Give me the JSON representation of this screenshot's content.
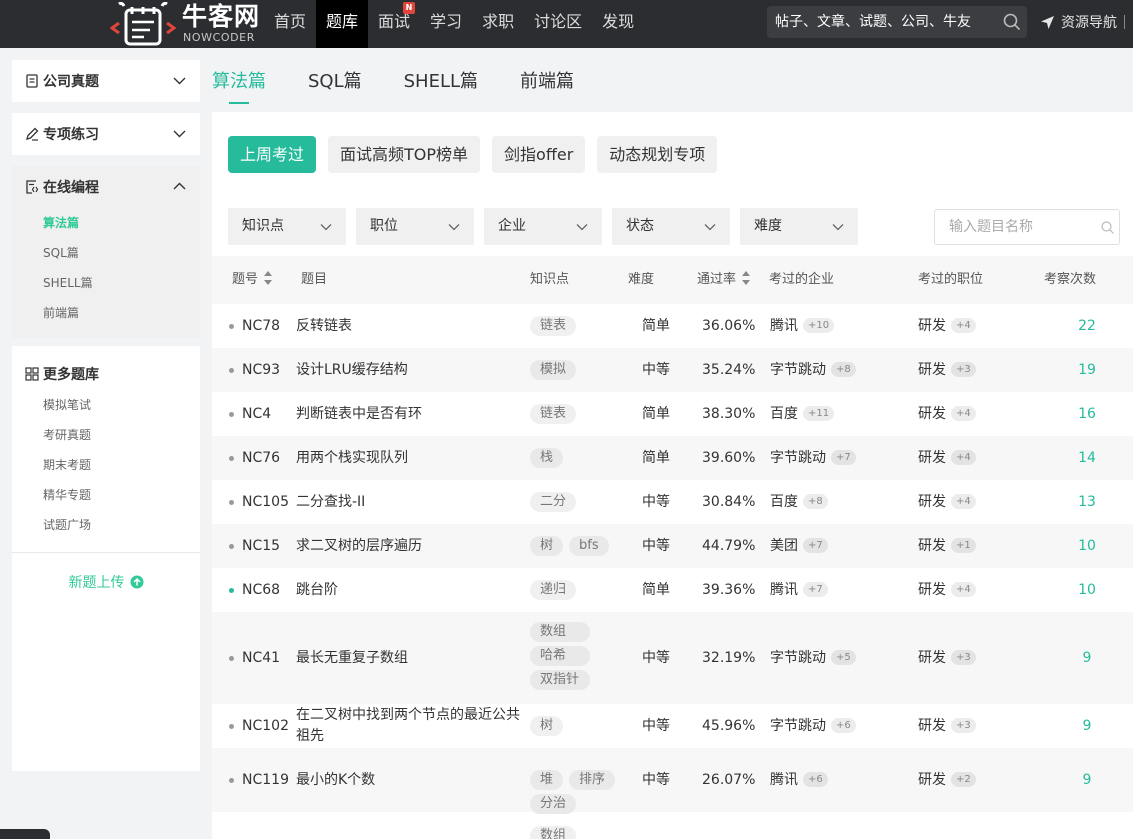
{
  "brand": {
    "name_cn": "牛客网",
    "name_en": "NOWCODER",
    "accent": "#25bb9b",
    "topbar_color": "#2b2d30"
  },
  "nav": {
    "items": [
      "首页",
      "题库",
      "面试",
      "学习",
      "求职",
      "讨论区",
      "发现"
    ],
    "active": "题库",
    "badge": "N"
  },
  "search": {
    "placeholder": "帖子、文章、试题、公司、牛友"
  },
  "resource_nav": "资源导航",
  "sidebar": {
    "sections": [
      {
        "label": "公司真题",
        "icon": "document-icon",
        "expanded": false
      },
      {
        "label": "专项练习",
        "icon": "pencil-icon",
        "expanded": false
      },
      {
        "label": "在线编程",
        "icon": "code-file-icon",
        "expanded": true,
        "items": [
          "算法篇",
          "SQL篇",
          "SHELL篇",
          "前端篇"
        ],
        "active_item": "算法篇"
      }
    ],
    "more": {
      "title": "更多题库",
      "items": [
        "模拟笔试",
        "考研真题",
        "期末考题",
        "精华专题",
        "试题广场"
      ]
    },
    "upload": "新题上传"
  },
  "tabs": {
    "items": [
      "算法篇",
      "SQL篇",
      "SHELL篇",
      "前端篇"
    ],
    "active": "算法篇"
  },
  "quick_buttons": {
    "items": [
      "上周考过",
      "面试高频TOP榜单",
      "剑指offer",
      "动态规划专项"
    ],
    "active": "上周考过"
  },
  "filters": [
    "知识点",
    "职位",
    "企业",
    "状态",
    "难度"
  ],
  "question_search": {
    "placeholder": "输入题目名称"
  },
  "table": {
    "headers": {
      "id": "题号",
      "title": "题目",
      "tags": "知识点",
      "difficulty": "难度",
      "pass_rate": "通过率",
      "companies": "考过的企业",
      "positions": "考过的职位",
      "count": "考察次数"
    },
    "rows": [
      {
        "id": "NC78",
        "title": "反转链表",
        "tags": [
          "链表"
        ],
        "difficulty": "简单",
        "pass_rate": "36.06%",
        "company": "腾讯",
        "company_more": "+10",
        "position": "研发",
        "position_more": "+4",
        "count": "22",
        "done": false
      },
      {
        "id": "NC93",
        "title": "设计LRU缓存结构",
        "tags": [
          "模拟"
        ],
        "difficulty": "中等",
        "pass_rate": "35.24%",
        "company": "字节跳动",
        "company_more": "+8",
        "position": "研发",
        "position_more": "+3",
        "count": "19",
        "done": false
      },
      {
        "id": "NC4",
        "title": "判断链表中是否有环",
        "tags": [
          "链表"
        ],
        "difficulty": "简单",
        "pass_rate": "38.30%",
        "company": "百度",
        "company_more": "+11",
        "position": "研发",
        "position_more": "+4",
        "count": "16",
        "done": false
      },
      {
        "id": "NC76",
        "title": "用两个栈实现队列",
        "tags": [
          "栈"
        ],
        "difficulty": "简单",
        "pass_rate": "39.60%",
        "company": "字节跳动",
        "company_more": "+7",
        "position": "研发",
        "position_more": "+4",
        "count": "14",
        "done": false
      },
      {
        "id": "NC105",
        "title": "二分查找-II",
        "tags": [
          "二分"
        ],
        "difficulty": "中等",
        "pass_rate": "30.84%",
        "company": "百度",
        "company_more": "+8",
        "position": "研发",
        "position_more": "+4",
        "count": "13",
        "done": false
      },
      {
        "id": "NC15",
        "title": "求二叉树的层序遍历",
        "tags": [
          "树",
          "bfs"
        ],
        "difficulty": "中等",
        "pass_rate": "44.79%",
        "company": "美团",
        "company_more": "+7",
        "position": "研发",
        "position_more": "+1",
        "count": "10",
        "done": false
      },
      {
        "id": "NC68",
        "title": "跳台阶",
        "tags": [
          "递归"
        ],
        "difficulty": "简单",
        "pass_rate": "39.36%",
        "company": "腾讯",
        "company_more": "+7",
        "position": "研发",
        "position_more": "+4",
        "count": "10",
        "done": true
      },
      {
        "id": "NC41",
        "title": "最长无重复子数组",
        "tags": [
          "数组",
          "哈希",
          "双指针"
        ],
        "difficulty": "中等",
        "pass_rate": "32.19%",
        "company": "字节跳动",
        "company_more": "+5",
        "position": "研发",
        "position_more": "+3",
        "count": "9",
        "done": false
      },
      {
        "id": "NC102",
        "title": "在二叉树中找到两个节点的最近公共祖先",
        "tags": [
          "树"
        ],
        "difficulty": "中等",
        "pass_rate": "45.96%",
        "company": "字节跳动",
        "company_more": "+6",
        "position": "研发",
        "position_more": "+3",
        "count": "9",
        "done": false
      },
      {
        "id": "NC119",
        "title": "最小的K个数",
        "tags": [
          "堆",
          "排序",
          "分治"
        ],
        "difficulty": "中等",
        "pass_rate": "26.07%",
        "company": "腾讯",
        "company_more": "+6",
        "position": "研发",
        "position_more": "+2",
        "count": "9",
        "done": false
      },
      {
        "id": "",
        "title": "",
        "tags": [
          "数组"
        ],
        "difficulty": "",
        "pass_rate": "",
        "company": "",
        "company_more": "",
        "position": "",
        "position_more": "",
        "count": "",
        "done": false
      }
    ]
  }
}
